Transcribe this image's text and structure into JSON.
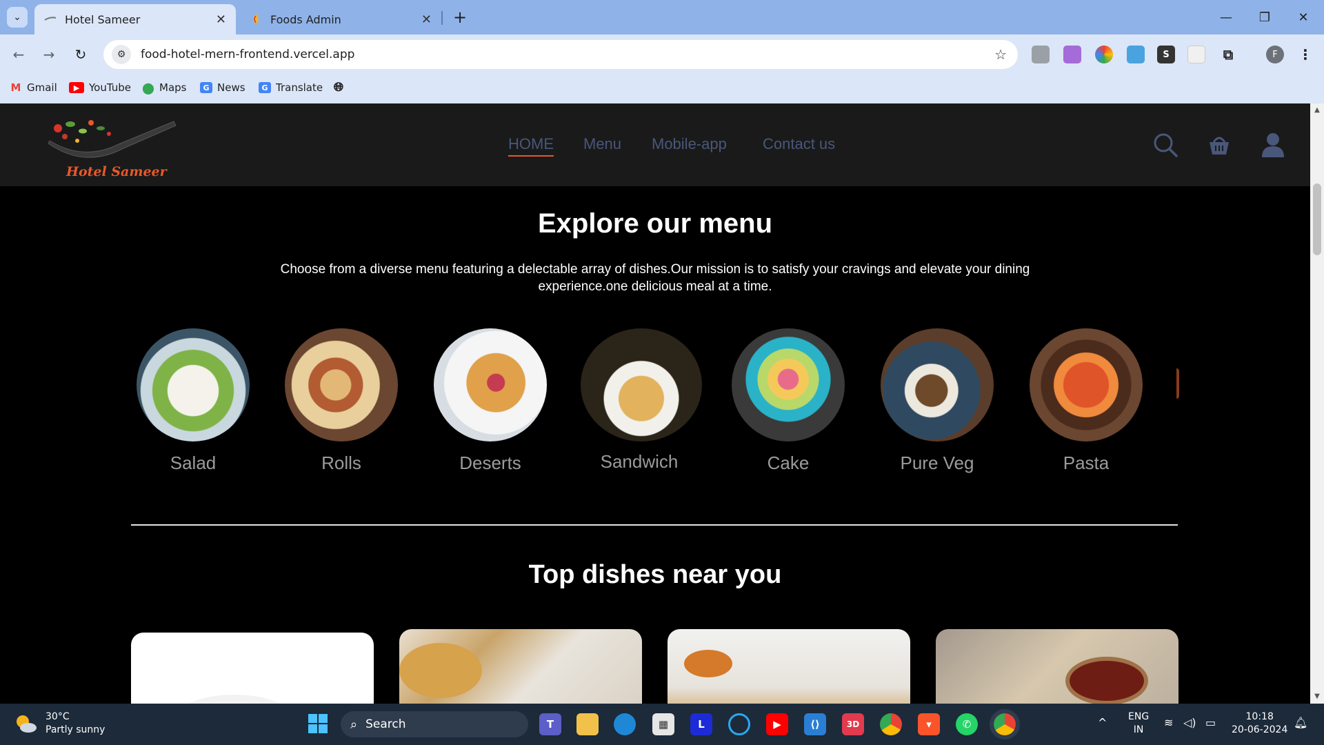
{
  "browser": {
    "tabs": [
      {
        "label": "Hotel Sameer",
        "active": true,
        "icon": "hotel-favicon"
      },
      {
        "label": "Foods Admin",
        "active": false,
        "icon": "foods-admin-favicon"
      }
    ],
    "url": "food-hotel-mern-frontend.vercel.app",
    "bookmarks": [
      {
        "label": "Gmail",
        "icon": "gmail-icon",
        "color": "#ea4335"
      },
      {
        "label": "YouTube",
        "icon": "youtube-icon",
        "color": "#ff0000"
      },
      {
        "label": "Maps",
        "icon": "maps-icon",
        "color": "#34a853"
      },
      {
        "label": "News",
        "icon": "news-icon",
        "color": "#4285f4"
      },
      {
        "label": "Translate",
        "icon": "translate-icon",
        "color": "#4285f4"
      }
    ],
    "profile_initial": "F"
  },
  "site": {
    "logo_text": "Hotel Sameer",
    "nav": [
      "HOME",
      "Menu",
      "Mobile-app",
      "Contact us"
    ],
    "accent": "#e8582b"
  },
  "explore": {
    "title": "Explore our menu",
    "description": "Choose from a diverse menu featuring a delectable array of dishes.Our mission is to satisfy your cravings and elevate your dining experience.one delicious meal at a time.",
    "categories": [
      "Salad",
      "Rolls",
      "Deserts",
      "Sandwich",
      "Cake",
      "Pure Veg",
      "Pasta"
    ]
  },
  "top_dishes": {
    "title": "Top dishes near you"
  },
  "taskbar": {
    "weather_temp": "30°C",
    "weather_desc": "Partly sunny",
    "search_label": "Search",
    "lang_line1": "ENG",
    "lang_line2": "IN",
    "time": "10:18",
    "date": "20-06-2024"
  }
}
